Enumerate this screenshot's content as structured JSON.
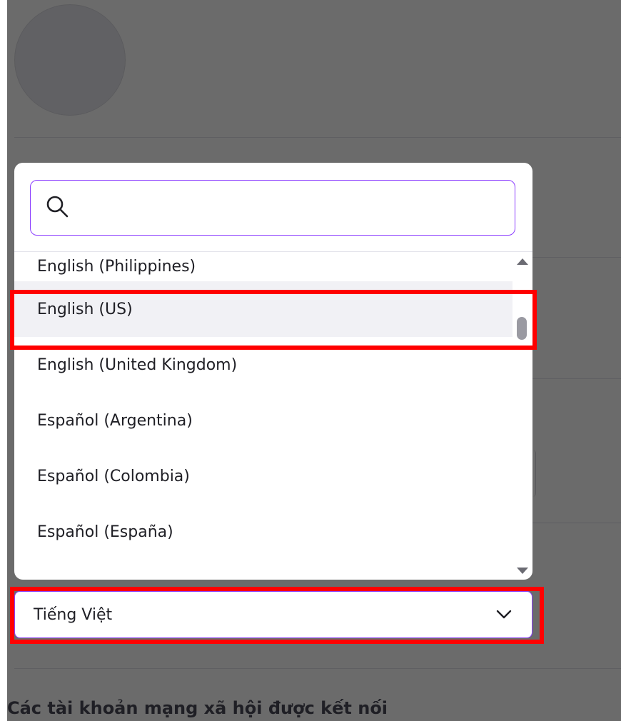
{
  "page": {
    "section_heading": "Các tài khoản mạng xã hội được kết nối"
  },
  "language_select": {
    "selected_value": "Tiếng Việt",
    "icon": "chevron-down-icon"
  },
  "dropdown": {
    "search": {
      "placeholder": "",
      "icon": "search-icon"
    },
    "options": [
      "English (Philippines)",
      "English (US)",
      "English (United Kingdom)",
      "Español (Argentina)",
      "Español (Colombia)",
      "Español (España)"
    ],
    "highlighted_option": "English (US)",
    "scroll_position": 0.2
  },
  "colors": {
    "overlay": "#000000",
    "accent": "#8b3dff",
    "annotation": "#ff0000",
    "option_hover": "#f1f1f5"
  }
}
